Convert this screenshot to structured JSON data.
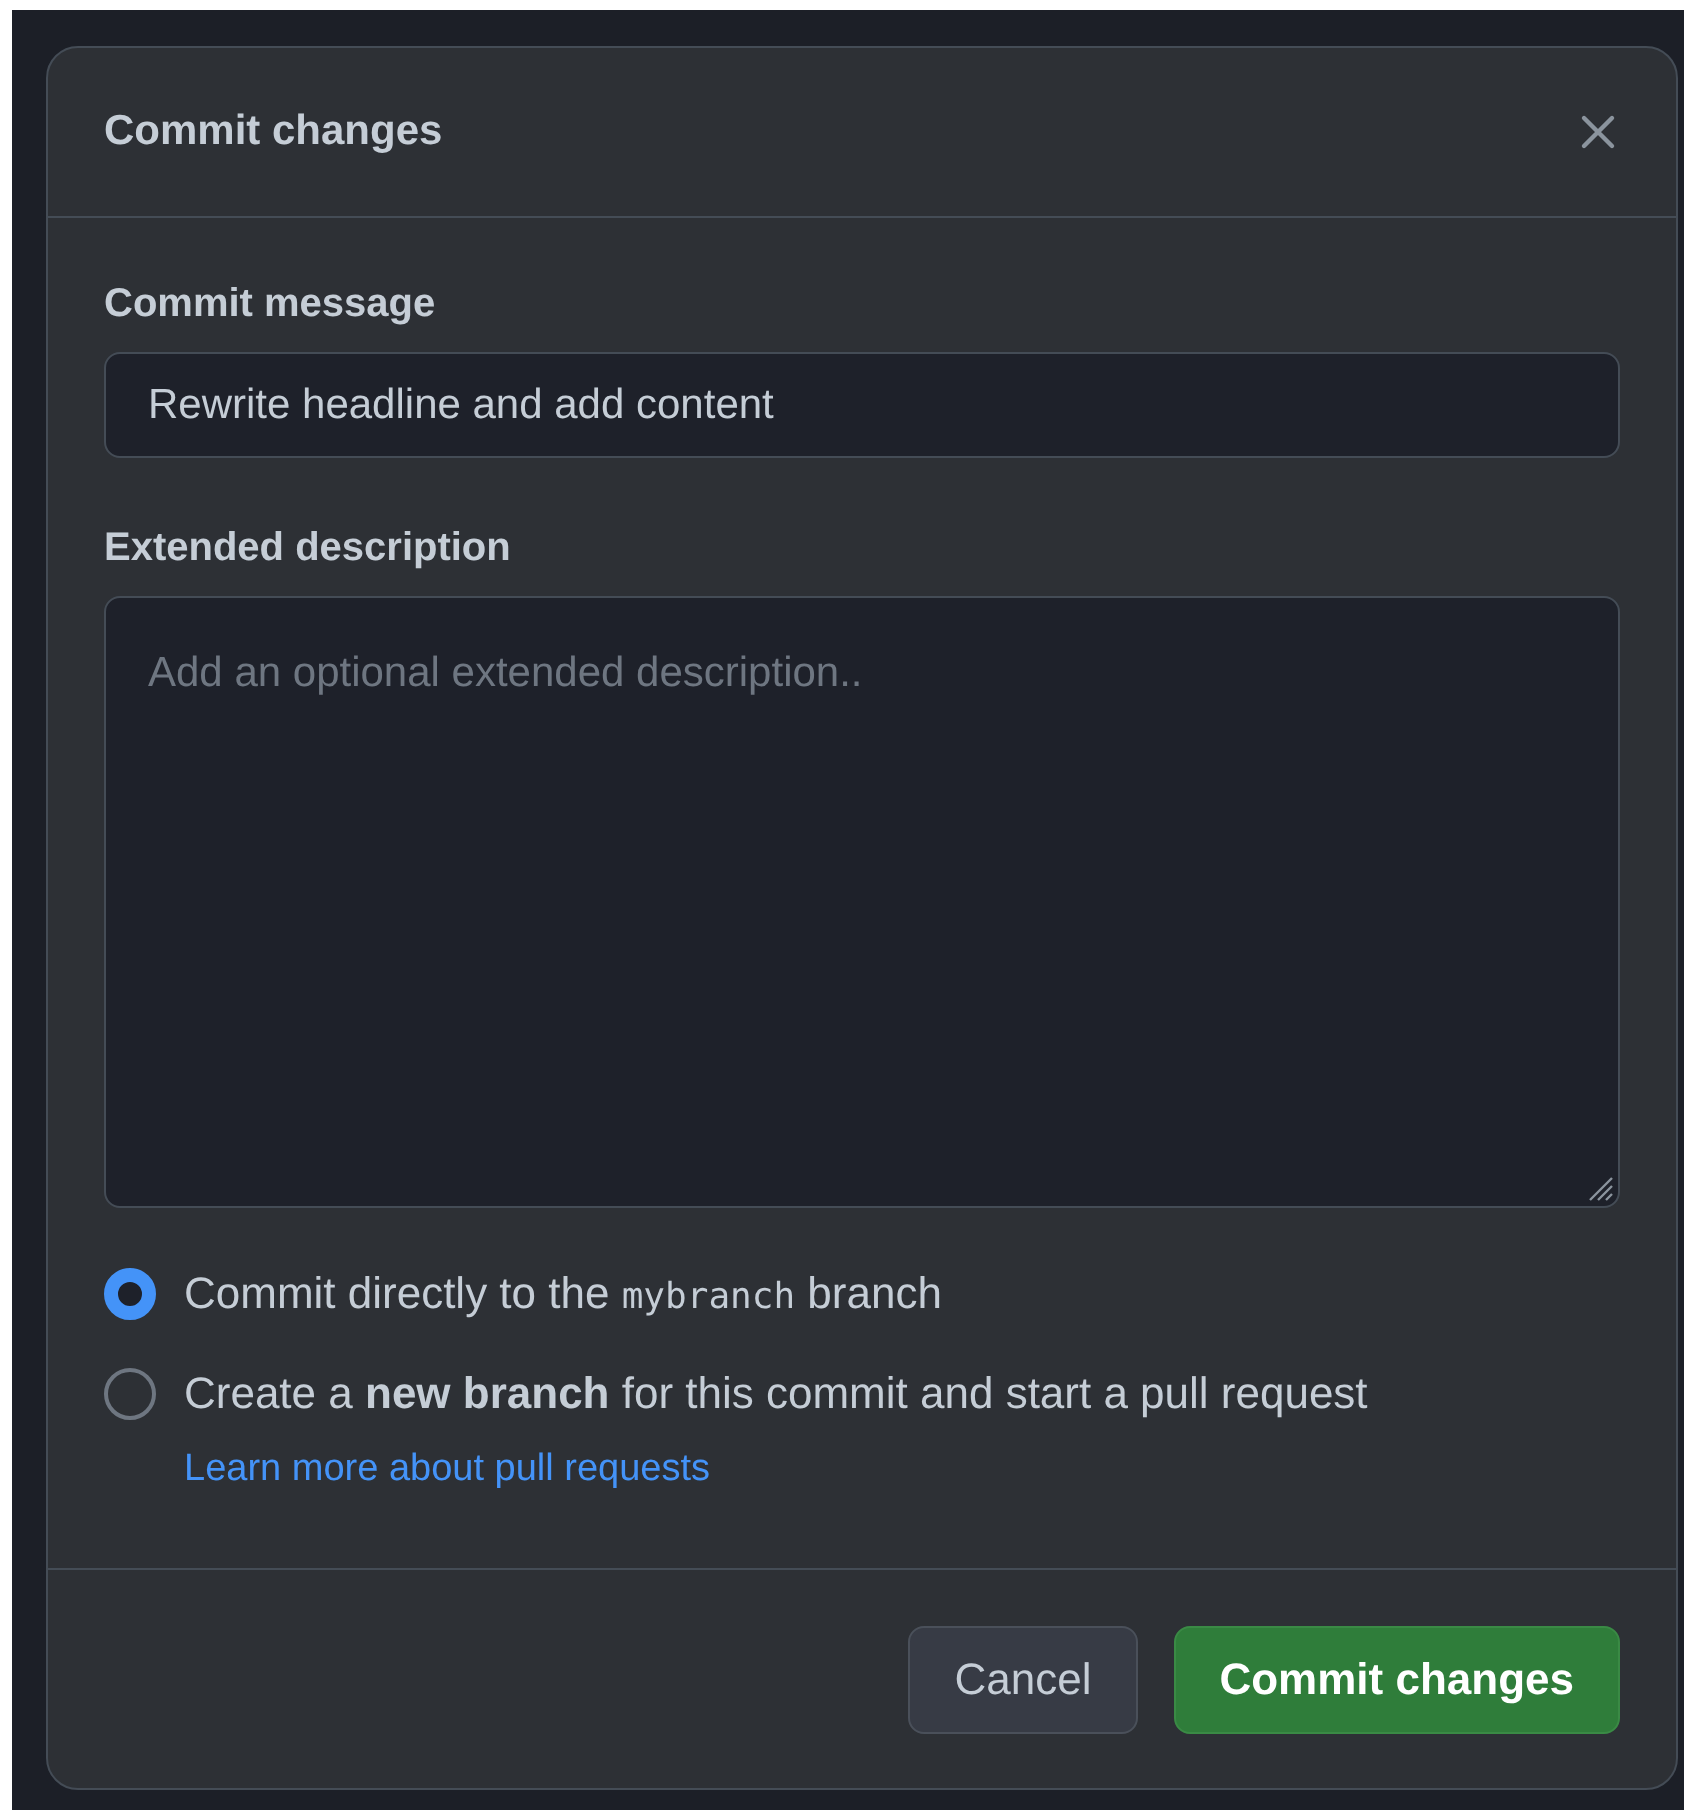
{
  "dialog": {
    "title": "Commit changes"
  },
  "commit_message": {
    "label": "Commit message",
    "value": "Rewrite headline and add content"
  },
  "extended_description": {
    "label": "Extended description",
    "placeholder": "Add an optional extended description.."
  },
  "options": [
    {
      "kind": "direct",
      "text_before": "Commit directly to the",
      "branch": "mybranch",
      "text_after": "branch",
      "selected": true
    },
    {
      "kind": "new_branch",
      "text": "Create a **new branch** for this commit and start a pull request",
      "link": "Learn more about pull requests",
      "selected": false
    }
  ],
  "buttons": [
    {
      "kind": "secondary",
      "label": "Cancel"
    },
    {
      "kind": "primary",
      "label": "Commit changes"
    }
  ]
}
